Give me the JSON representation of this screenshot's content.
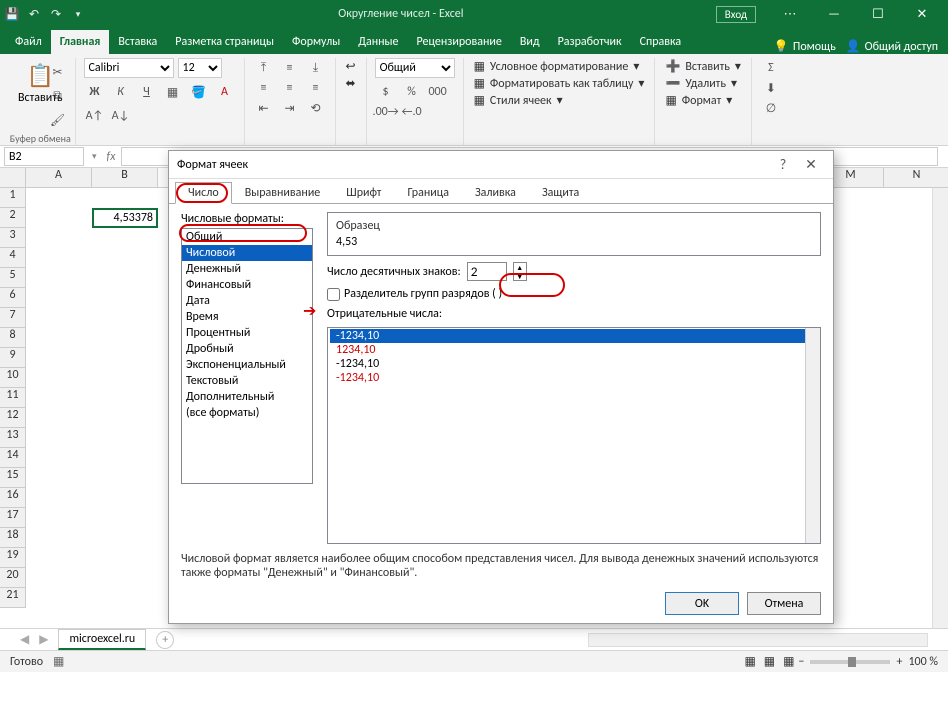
{
  "titlebar": {
    "title": "Округление чисел - Excel",
    "signin": "Вход"
  },
  "tabs": {
    "file": "Файл",
    "home": "Главная",
    "insert": "Вставка",
    "layout": "Разметка страницы",
    "formulas": "Формулы",
    "data": "Данные",
    "review": "Рецензирование",
    "view": "Вид",
    "developer": "Разработчик",
    "help": "Справка",
    "tellme": "Помощь",
    "share": "Общий доступ"
  },
  "ribbon": {
    "paste": "Вставить",
    "clipboard_label": "Буфер обмена",
    "font_name": "Calibri",
    "font_size": "12",
    "bold": "Ж",
    "italic": "К",
    "underline": "Ч",
    "number_format": "Общий",
    "cond_format": "Условное форматирование",
    "format_table": "Форматировать как таблицу",
    "cell_styles": "Стили ячеек",
    "insert_cells": "Вставить",
    "delete_cells": "Удалить",
    "format_cells": "Формат"
  },
  "namebox": "B2",
  "columns": [
    "A",
    "B",
    "M",
    "N"
  ],
  "rows": [
    "1",
    "2",
    "3",
    "4",
    "5",
    "6",
    "7",
    "8",
    "9",
    "10",
    "11",
    "12",
    "13",
    "14",
    "15",
    "16",
    "17",
    "18",
    "19",
    "20",
    "21"
  ],
  "cell_b2": "4,53378",
  "sheet_tab": "microexcel.ru",
  "statusbar": {
    "ready": "Готово",
    "zoom": "100 %"
  },
  "dialog": {
    "title": "Формат ячеек",
    "tabs": {
      "number": "Число",
      "alignment": "Выравнивание",
      "font": "Шрифт",
      "border": "Граница",
      "fill": "Заливка",
      "protection": "Защита"
    },
    "categories_label": "Числовые форматы:",
    "categories": [
      "Общий",
      "Числовой",
      "Денежный",
      "Финансовый",
      "Дата",
      "Время",
      "Процентный",
      "Дробный",
      "Экспоненциальный",
      "Текстовый",
      "Дополнительный",
      "(все форматы)"
    ],
    "selected_category_index": 1,
    "sample_label": "Образец",
    "sample_value": "4,53",
    "decimals_label": "Число десятичных знаков:",
    "decimals_value": "2",
    "separator_label": "Разделитель групп разрядов ( )",
    "negative_label": "Отрицательные числа:",
    "negatives": [
      "-1234,10",
      "1234,10",
      "-1234,10",
      "-1234,10"
    ],
    "description": "Числовой формат является наиболее общим способом представления чисел. Для вывода денежных значений используются также форматы \"Денежный\" и \"Финансовый\".",
    "ok": "OK",
    "cancel": "Отмена"
  }
}
